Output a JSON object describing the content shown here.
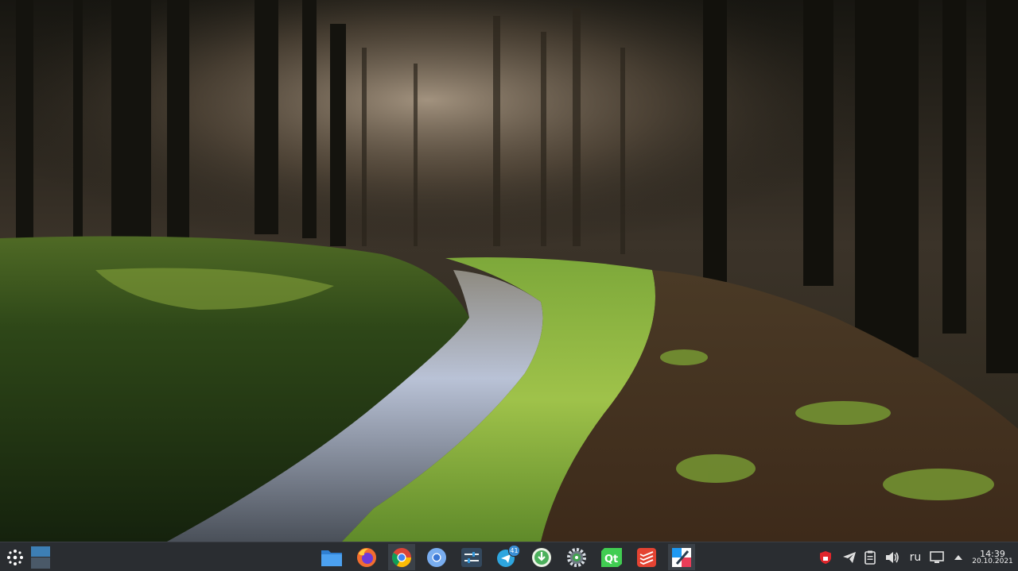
{
  "taskbar": {
    "launcher": {
      "icon": "app-launcher-icon"
    },
    "pager": {
      "icon": "desktop-pager-icon"
    },
    "apps": [
      {
        "id": "files",
        "icon": "file-manager-icon",
        "color": "#3c8ee6"
      },
      {
        "id": "firefox",
        "icon": "firefox-icon",
        "color": "#ff7139"
      },
      {
        "id": "chrome",
        "icon": "chrome-icon",
        "color": "#4285f4"
      },
      {
        "id": "chromium",
        "icon": "chromium-icon",
        "color": "#5d9cec"
      },
      {
        "id": "mixer",
        "icon": "settings-sliders-icon",
        "color": "#34495e"
      },
      {
        "id": "telegram",
        "icon": "telegram-icon",
        "color": "#2ea6df",
        "badge": "41"
      },
      {
        "id": "downloader",
        "icon": "download-icon",
        "color": "#4cb05c"
      },
      {
        "id": "settings",
        "icon": "gear-icon",
        "color": "#3fa34d"
      },
      {
        "id": "qt",
        "icon": "qt-creator-icon",
        "color": "#41cd52"
      },
      {
        "id": "todoist",
        "icon": "todoist-icon",
        "color": "#e44332"
      },
      {
        "id": "kate",
        "icon": "kate-editor-icon",
        "color": "#1d99f3",
        "active": true
      }
    ]
  },
  "tray": {
    "shield": {
      "icon": "shield-icon",
      "color": "#e0262b"
    },
    "telegram_tray": {
      "icon": "telegram-tray-icon"
    },
    "clipboard": {
      "icon": "clipboard-icon"
    },
    "volume": {
      "icon": "volume-icon"
    },
    "language": "ru",
    "network": {
      "icon": "network-monitor-icon"
    },
    "expand": {
      "icon": "chevron-up-icon"
    },
    "clock": {
      "time": "14:39",
      "date": "20.10.2021"
    }
  }
}
